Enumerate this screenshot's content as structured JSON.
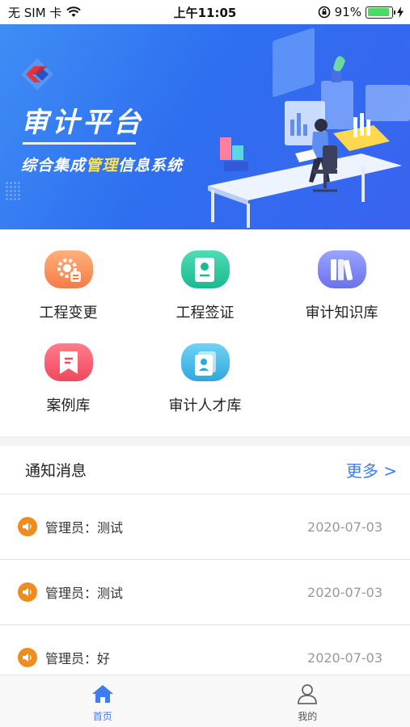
{
  "status_bar": {
    "carrier": "无 SIM 卡",
    "time": "上午11:05",
    "battery": "91%",
    "battery_level": 0.91
  },
  "banner": {
    "title": "审计平台",
    "subtitle_pre": "综合集成",
    "subtitle_hl": "管理",
    "subtitle_post": "信息系统"
  },
  "grid": {
    "items": [
      {
        "label": "工程变更",
        "icon": "gear-icon",
        "color": "#f59a5a"
      },
      {
        "label": "工程签证",
        "icon": "certificate-icon",
        "color": "#2fc6a0"
      },
      {
        "label": "审计知识库",
        "icon": "books-icon",
        "color": "#7d86f2"
      },
      {
        "label": "案例库",
        "icon": "bookmark-icon",
        "color": "#f5596b"
      },
      {
        "label": "审计人才库",
        "icon": "profile-cards-icon",
        "color": "#3fb8e8"
      }
    ]
  },
  "notices": {
    "title": "通知消息",
    "more": "更多 >",
    "items": [
      {
        "text": "管理员：测试",
        "date": "2020-07-03"
      },
      {
        "text": "管理员：测试",
        "date": "2020-07-03"
      },
      {
        "text": "管理员：好",
        "date": "2020-07-03"
      }
    ]
  },
  "tabbar": {
    "home": "首页",
    "mine": "我的"
  },
  "colors": {
    "accent": "#3d7df0",
    "notice_icon": "#f08c1e"
  }
}
